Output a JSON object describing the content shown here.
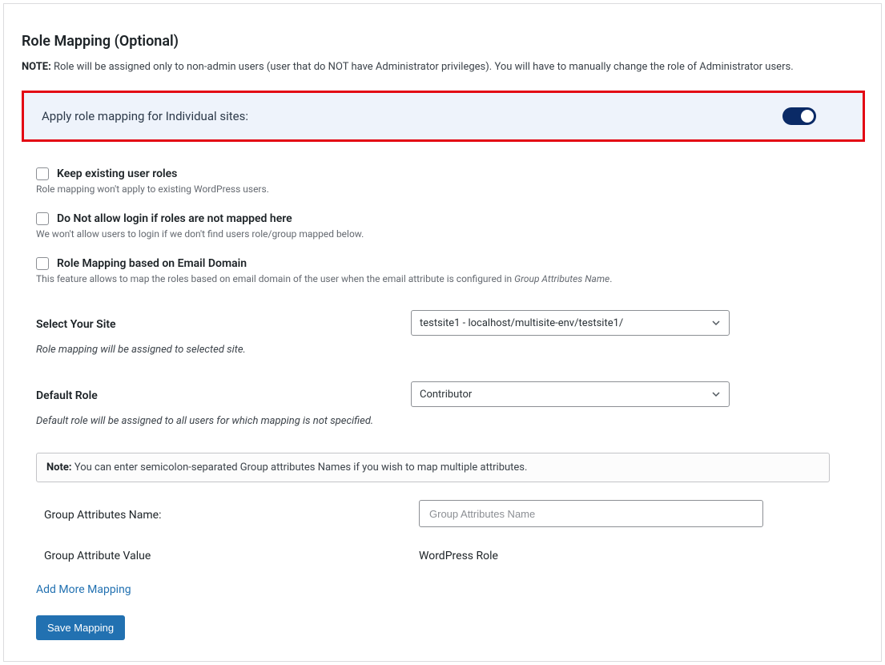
{
  "header": {
    "title": "Role Mapping (Optional)",
    "note_label": "NOTE:",
    "note_text": " Role will be assigned only to non-admin users (user that do NOT have Administrator privileges). You will have to manually change the role of Administrator users."
  },
  "highlight": {
    "label": "Apply role mapping for Individual sites:",
    "toggle_on": true
  },
  "options": {
    "keep_roles": {
      "label": "Keep existing user roles",
      "help": "Role mapping won't apply to existing WordPress users."
    },
    "no_login": {
      "label": "Do Not allow login if roles are not mapped here",
      "help": "We won't allow users to login if we don't find users role/group mapped below."
    },
    "email_domain": {
      "label": "Role Mapping based on Email Domain",
      "help_prefix": "This feature allows to map the roles based on email domain of the user when the email attribute is configured in ",
      "help_em": "Group Attributes Name",
      "help_suffix": "."
    }
  },
  "site": {
    "label": "Select Your Site",
    "help": "Role mapping will be assigned to selected site.",
    "selected": "testsite1 - localhost/multisite-env/testsite1/"
  },
  "default_role": {
    "label": "Default Role",
    "help": "Default role will be assigned to all users for which mapping is not specified.",
    "selected": "Contributor"
  },
  "info_box": {
    "label": "Note:",
    "text": " You can enter semicolon-separated Group attributes Names if you wish to map multiple attributes."
  },
  "group_attr_name": {
    "label": "Group Attributes Name:",
    "placeholder": "Group Attributes Name"
  },
  "pair_header": {
    "left": "Group Attribute Value",
    "right": "WordPress Role"
  },
  "actions": {
    "add_more": "Add More Mapping",
    "save": "Save Mapping"
  }
}
